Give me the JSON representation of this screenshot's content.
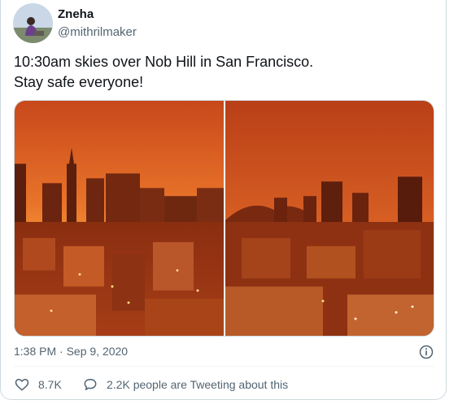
{
  "tweet": {
    "author_name": "Zneha",
    "author_handle": "@mithrilmaker",
    "text_lines": [
      "10:30am skies over Nob Hill in San Francisco.",
      "Stay safe everyone!"
    ],
    "timestamp": "1:38 PM · Sep 9, 2020",
    "likes": "8.7K",
    "conversation": "2.2K people are Tweeting about this"
  },
  "icons": {
    "info": "info-icon",
    "like": "heart-icon",
    "conversation": "speech-bubble-icon"
  },
  "colors": {
    "sky_orange": "#e8782a",
    "sky_deep": "#c24a16",
    "city_dark": "#5a1d0c",
    "text_secondary": "#536471"
  }
}
